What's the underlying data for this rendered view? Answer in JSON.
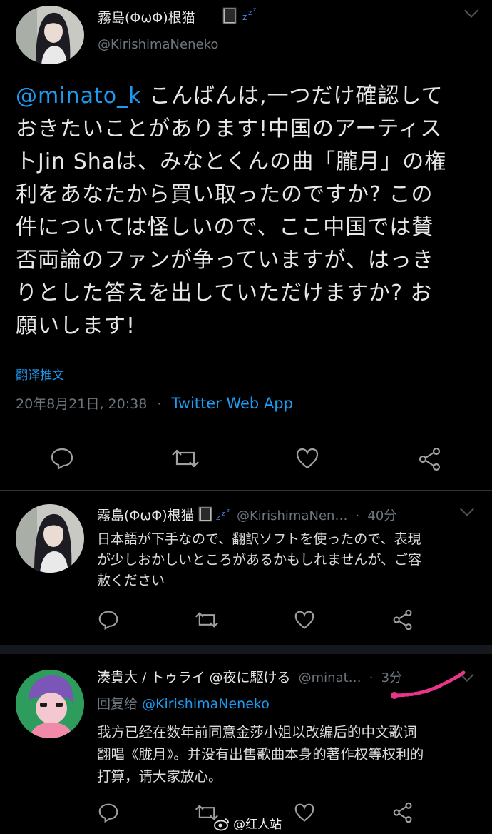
{
  "tweet1": {
    "name": "霧島(ΦωΦ)根猫",
    "handle": "@KirishimaNeneko",
    "mention": "@minato_k",
    "text_lines": [
      "こんばんは,一つだけ確認して",
      "おきたいことがあります!中国のアーティス",
      "トJin Shaは、みなとくんの曲「朧月」の権",
      "利をあなたから買い取ったのですか? この",
      "件については怪しいので、ここ中国では賛",
      "否両論のファンが争っていますが、はっき",
      "りとした答えを出していただけますか? お",
      "願いします!"
    ],
    "translate": "翻译推文",
    "date": "20年8月21日, 20:38",
    "dot": "·",
    "source": "Twitter Web App"
  },
  "reply1": {
    "name": "霧島(ΦωΦ)根猫",
    "handle": "@KirishimaNen…",
    "dot": "·",
    "time": "40分",
    "text_lines": [
      "日本語が下手なので、翻訳ソフトを使ったので、表現",
      "が少しおかしいところがあるかもしれませんが、ご容",
      "赦ください"
    ]
  },
  "reply2": {
    "name": "湊貴大 / トゥライ @夜に駆ける",
    "handle": "@minat…",
    "dot": "·",
    "time": "3分",
    "reply_prefix": "回复给",
    "reply_to": "@KirishimaNeneko",
    "text_lines": [
      "我方已经在数年前同意金莎小姐以改编后的中文歌词",
      "翻唱《胧月》。并没有出售歌曲本身的著作权等权利的",
      "打算，请大家放心。"
    ]
  },
  "watermark": "@红人站",
  "colors": {
    "background": "#000000",
    "link": "#1d9bf0",
    "muted": "#6e767d",
    "annotation": "#e8358a"
  },
  "icons": [
    "reply-icon",
    "retweet-icon",
    "like-icon",
    "share-icon",
    "sleep-icon",
    "notebook-icon",
    "chevron-down-icon",
    "weibo-icon"
  ]
}
